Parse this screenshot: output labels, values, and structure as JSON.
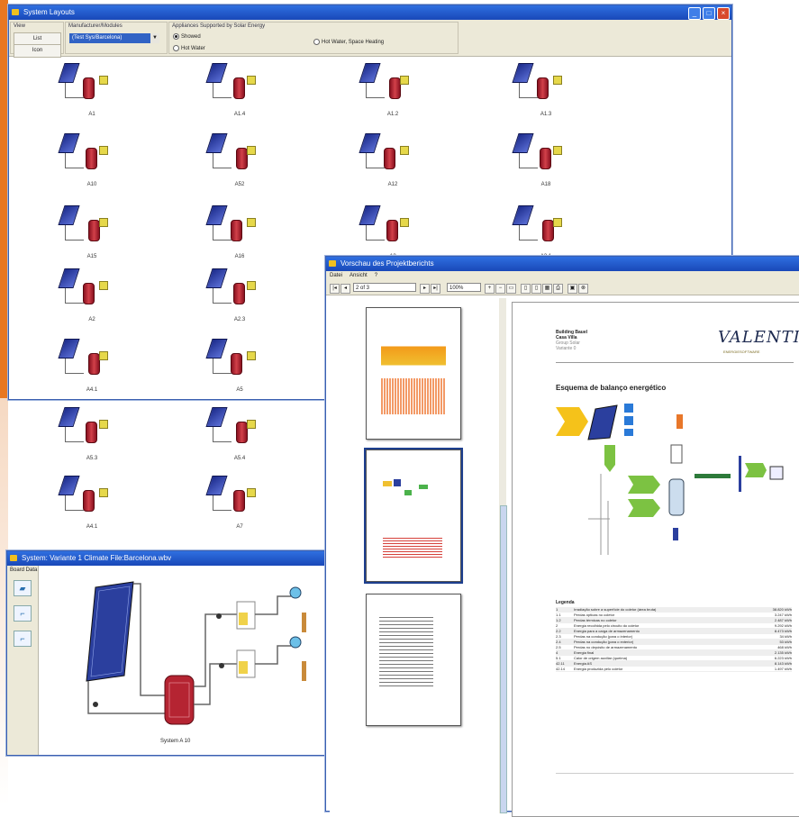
{
  "colors": {
    "accent": "#e87722",
    "titlebar": "#2f6fe0",
    "panel": "#2a3aa0",
    "tank": "#b02230"
  },
  "window1": {
    "title": "System Layouts",
    "groups": {
      "view": {
        "label": "View",
        "buttons": [
          "List",
          "Icon"
        ]
      },
      "manufacturer": {
        "label": "Manufacturer/Modules",
        "selected": "(Test Sys/Barcelona)"
      },
      "appliances": {
        "label": "Appliances Supported by Solar Energy",
        "options": [
          "Showed",
          "Hot Water",
          "Hot Water, Space Heating"
        ]
      }
    },
    "thumbnails": [
      {
        "label": "A1"
      },
      {
        "label": "A1.4"
      },
      {
        "label": "A1.2"
      },
      {
        "label": "A1.3"
      },
      {
        "label": "A10"
      },
      {
        "label": "A52"
      },
      {
        "label": "A12"
      },
      {
        "label": "A18"
      },
      {
        "label": "A15"
      },
      {
        "label": "A16"
      },
      {
        "label": "A3"
      },
      {
        "label": "A3.1"
      },
      {
        "label": "A2"
      },
      {
        "label": "A2.3"
      },
      {
        "label": "A4.1"
      },
      {
        "label": "A5"
      },
      {
        "label": "A5.3"
      },
      {
        "label": "A5.4"
      },
      {
        "label": "A4.1"
      },
      {
        "label": "A7"
      }
    ]
  },
  "window2": {
    "title": "System: Variante 1    Climate File:Barcelona.wbv",
    "side_label": "Board Data",
    "caption": "System A 10"
  },
  "window3": {
    "title": "Vorschau des Projektberichts",
    "menu": [
      "Datei",
      "Ansicht",
      "?"
    ],
    "page_field": "2 of 3",
    "zoom_field": "100%",
    "report": {
      "header_lines": [
        "Building Bauel",
        "Casa Villa",
        "Group Solar",
        "Variante 0"
      ],
      "logo": "VALENTIN",
      "logo_sub": "ENERGIESOFTWARE",
      "section_title": "Esquema de balanço energético",
      "legend_title": "Legenda",
      "legend": [
        {
          "k": "1",
          "t": "Irradiação sobre a superfície do coletor (área bruta)",
          "v": "38.820 kWh"
        },
        {
          "k": "1.1",
          "t": "Perdas ópticas no coletor",
          "v": "3.247 kWh"
        },
        {
          "k": "1.2",
          "t": "Perdas térmicas no coletor",
          "v": "2.487 kWh"
        },
        {
          "k": "2",
          "t": "Energia recolhida pelo circuito do coletor",
          "v": "9.292 kWh"
        },
        {
          "k": "2.2",
          "t": "Energia para a carga de armazenamento",
          "v": "8.473 kWh"
        },
        {
          "k": "2.3",
          "t": "Perdas na condução (para o interior)",
          "v": "34 kWh"
        },
        {
          "k": "2.4",
          "t": "Perdas na condução (para o exterior)",
          "v": "53 kWh"
        },
        {
          "k": "2.5",
          "t": "Perdas no depósito de armazenamento",
          "v": "468 kWh"
        },
        {
          "k": "4",
          "t": "Energia final",
          "v": "2.135 kWh"
        },
        {
          "k": "5.1",
          "t": "Calor de origem auxiliar (queima)",
          "v": "6.223 kWh"
        },
        {
          "k": "42.11",
          "t": "Energia AS",
          "v": "8.143 kWh"
        },
        {
          "k": "42.14",
          "t": "Energia produzida pelo coletor",
          "v": "1.497 kWh"
        }
      ]
    }
  }
}
